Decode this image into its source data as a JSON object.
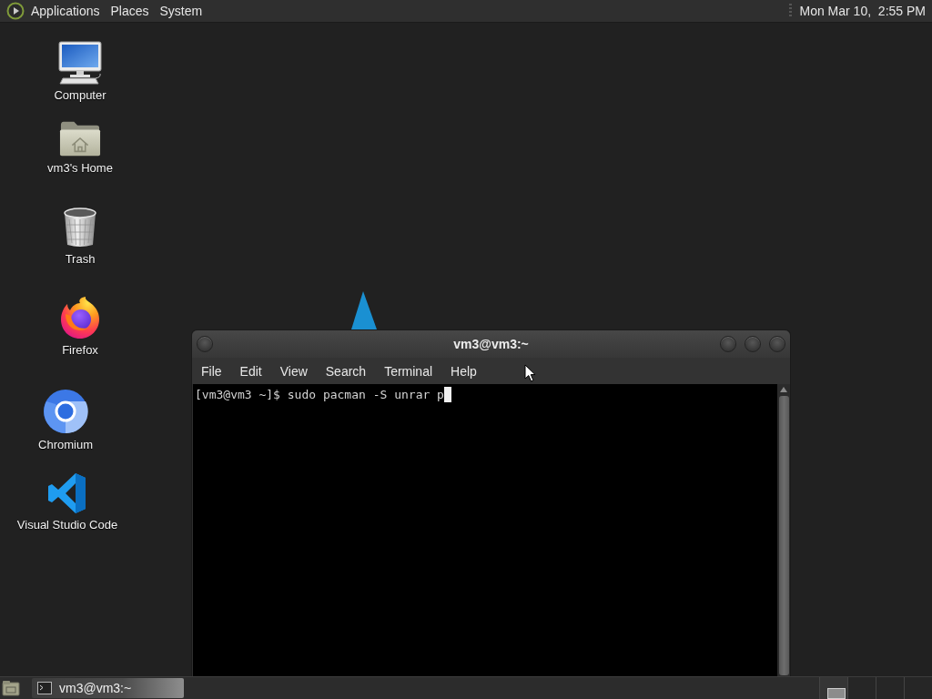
{
  "top_panel": {
    "menus": [
      {
        "label": "Applications"
      },
      {
        "label": "Places"
      },
      {
        "label": "System"
      }
    ],
    "clock": "Mon Mar 10,  2:55 PM"
  },
  "desktop_icons": [
    {
      "kind": "computer",
      "label": "Computer"
    },
    {
      "kind": "home",
      "label": "vm3's Home"
    },
    {
      "kind": "trash",
      "label": "Trash"
    },
    {
      "kind": "firefox",
      "label": "Firefox"
    },
    {
      "kind": "chromium",
      "label": "Chromium"
    },
    {
      "kind": "vscode",
      "label": "Visual Studio Code"
    }
  ],
  "terminal_window": {
    "title": "vm3@vm3:~",
    "menus": [
      "File",
      "Edit",
      "View",
      "Search",
      "Terminal",
      "Help"
    ],
    "lines": [
      "[vm3@vm3 ~]$ sudo pacman -S unrar p"
    ]
  },
  "taskbar": {
    "tasks": [
      {
        "label": "vm3@vm3:~",
        "selected": true
      }
    ],
    "workspaces": [
      {
        "selected": true
      },
      {
        "selected": false
      },
      {
        "selected": false
      },
      {
        "selected": false
      }
    ]
  }
}
